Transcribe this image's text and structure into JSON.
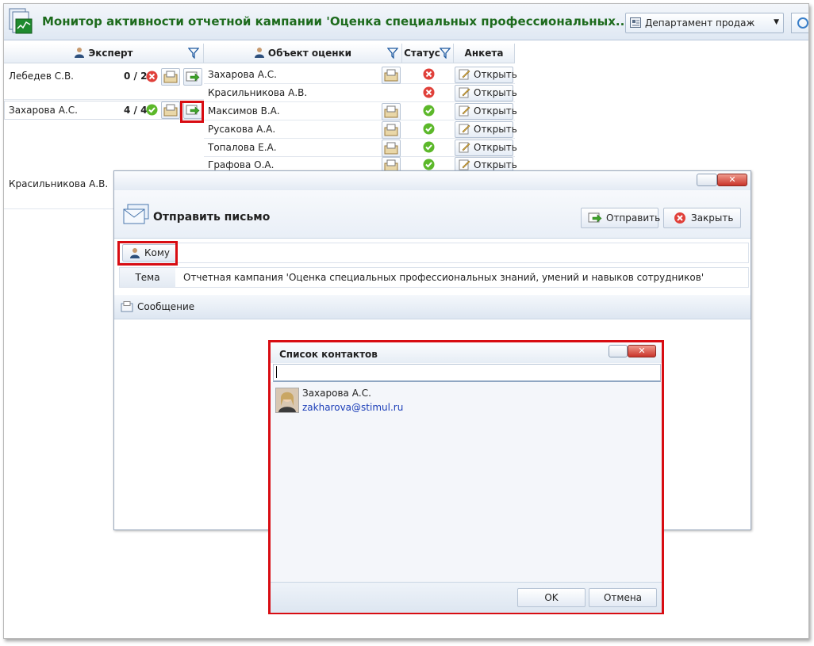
{
  "header": {
    "title": "Монитор активности отчетной кампании 'Оценка специальных профессиональных...",
    "department": "Департамент продаж"
  },
  "grid": {
    "columns": {
      "expert": "Эксперт",
      "object": "Объект оценки",
      "status": "Статус",
      "form": "Анкета"
    },
    "experts": [
      {
        "name": "Лебедев С.В.",
        "count": "0 / 2",
        "state": "error"
      },
      {
        "name": "Захарова А.С.",
        "count": "4 / 4",
        "state": "ok"
      },
      {
        "name": "Красильникова А.В.",
        "count": "",
        "state": ""
      }
    ],
    "objects": [
      {
        "name": "Захарова А.С.",
        "status": "error",
        "action": "Открыть"
      },
      {
        "name": "Красильникова А.В.",
        "status": "error",
        "action": "Открыть"
      },
      {
        "name": "Максимов В.А.",
        "status": "ok",
        "action": "Открыть"
      },
      {
        "name": "Русакова А.А.",
        "status": "ok",
        "action": "Открыть"
      },
      {
        "name": "Топалова Е.А.",
        "status": "ok",
        "action": "Открыть"
      },
      {
        "name": "Графова О.А.",
        "status": "ok",
        "action": "Открыть"
      }
    ]
  },
  "send_dialog": {
    "title": "Отправить письмо",
    "send_label": "Отправить",
    "close_label": "Закрыть",
    "to_label": "Кому",
    "subject_label": "Тема",
    "subject_value": "Отчетная кампания 'Оценка специальных профессиональных знаний, умений и навыков сотрудников'",
    "message_label": "Сообщение"
  },
  "contacts_dialog": {
    "title": "Список контактов",
    "search_value": "",
    "contacts": [
      {
        "name": "Захарова А.С.",
        "email": "zakharova@stimul.ru"
      }
    ],
    "ok_label": "OK",
    "cancel_label": "Отмена"
  },
  "colors": {
    "title_green": "#1d6b1d",
    "highlight_red": "#d80c12",
    "email_blue": "#1a3db8",
    "ok_green": "#5cb82a",
    "error_red": "#e0403a"
  }
}
